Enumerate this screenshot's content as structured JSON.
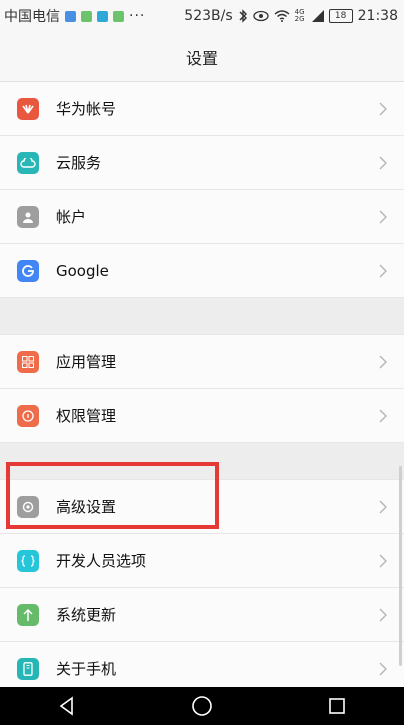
{
  "status": {
    "carrier": "中国电信",
    "speed": "523B/s",
    "signal_text": "4G 2G",
    "battery": "18",
    "time": "21:38",
    "more": "···"
  },
  "header": {
    "title": "设置"
  },
  "groups": [
    {
      "items": [
        {
          "label": "华为帐号",
          "icon": "huawei-icon",
          "color": "#e9573f"
        },
        {
          "label": "云服务",
          "icon": "cloud-icon",
          "color": "#29b6b6"
        },
        {
          "label": "帐户",
          "icon": "person-icon",
          "color": "#9e9e9e"
        },
        {
          "label": "Google",
          "icon": "google-icon",
          "color": "#4285f4"
        }
      ]
    },
    {
      "items": [
        {
          "label": "应用管理",
          "icon": "apps-icon",
          "color": "#ef6c4a"
        },
        {
          "label": "权限管理",
          "icon": "shield-icon",
          "color": "#ef6c4a"
        }
      ]
    },
    {
      "items": [
        {
          "label": "高级设置",
          "icon": "gear-icon",
          "color": "#9e9e9e"
        },
        {
          "label": "开发人员选项",
          "icon": "braces-icon",
          "color": "#26c6da"
        },
        {
          "label": "系统更新",
          "icon": "arrow-up-icon",
          "color": "#66bb6a"
        },
        {
          "label": "关于手机",
          "icon": "phone-icon",
          "color": "#26b6b6"
        }
      ]
    }
  ],
  "colors": {
    "highlight": "#e53935"
  }
}
